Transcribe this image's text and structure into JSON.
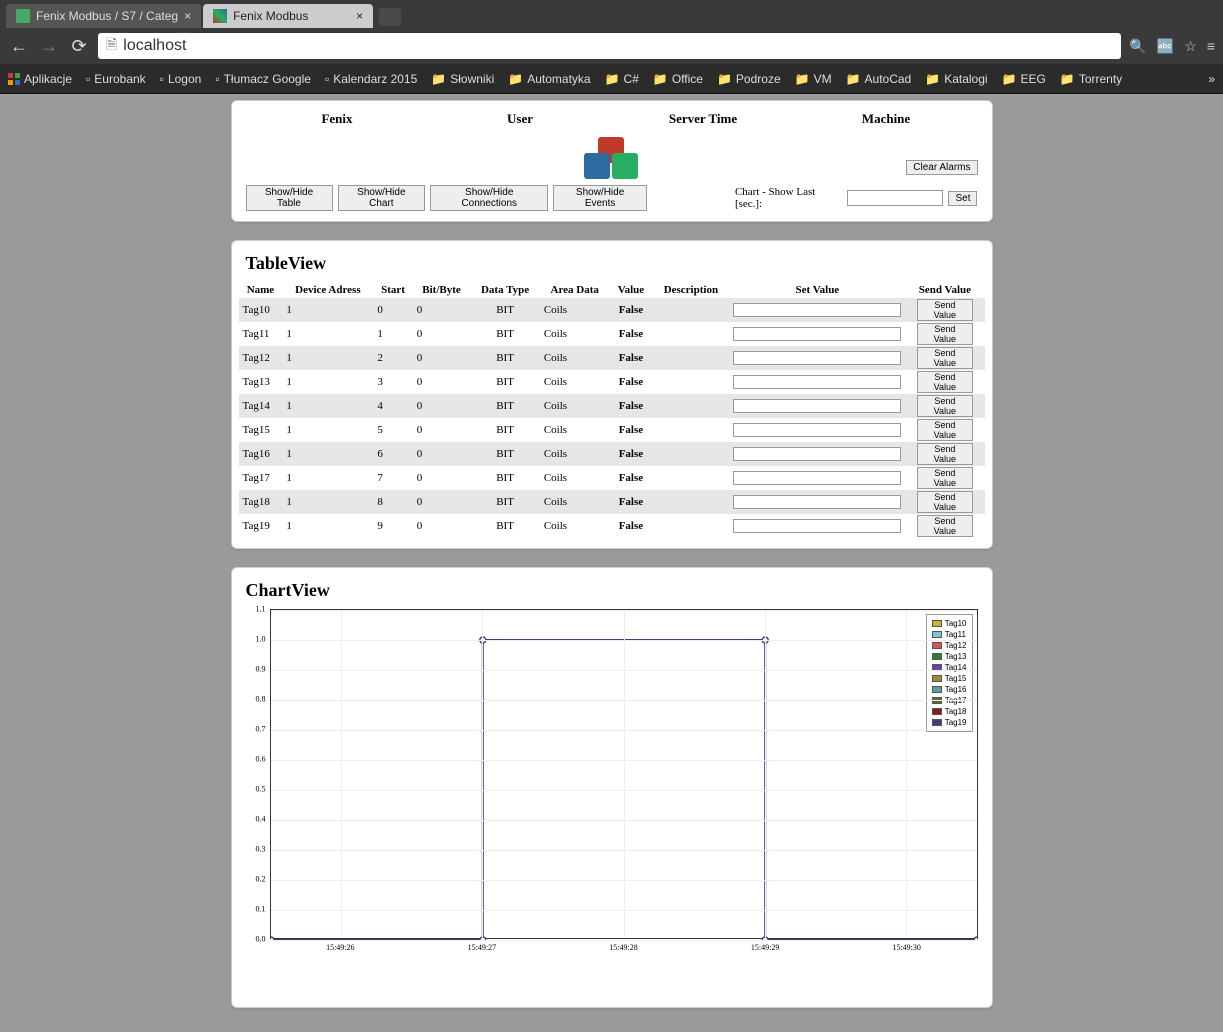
{
  "browser": {
    "tabs": [
      {
        "title": "Fenix Modbus / S7 / Categ",
        "active": false
      },
      {
        "title": "Fenix Modbus",
        "active": true
      }
    ],
    "url": "localhost",
    "bookmarks_label": "Aplikacje",
    "bookmarks": [
      {
        "label": "Eurobank",
        "type": "site"
      },
      {
        "label": "Logon",
        "type": "page"
      },
      {
        "label": "Tłumacz Google",
        "type": "site"
      },
      {
        "label": "Kalendarz 2015",
        "type": "site"
      },
      {
        "label": "Słowniki",
        "type": "folder"
      },
      {
        "label": "Automatyka",
        "type": "folder"
      },
      {
        "label": "C#",
        "type": "folder"
      },
      {
        "label": "Office",
        "type": "folder"
      },
      {
        "label": "Podroze",
        "type": "folder"
      },
      {
        "label": "VM",
        "type": "folder"
      },
      {
        "label": "AutoCad",
        "type": "folder"
      },
      {
        "label": "Katalogi",
        "type": "folder"
      },
      {
        "label": "EEG",
        "type": "folder"
      },
      {
        "label": "Torrenty",
        "type": "folder"
      }
    ]
  },
  "header": {
    "cols": [
      "Fenix",
      "User",
      "Server Time",
      "Machine"
    ],
    "clear_alarms": "Clear Alarms"
  },
  "controls": {
    "show_table": "Show/Hide Table",
    "show_chart": "Show/Hide Chart",
    "show_conn": "Show/Hide Connections",
    "show_events": "Show/Hide Events",
    "chart_last_label": "Chart - Show Last [sec.]:",
    "set": "Set"
  },
  "table": {
    "title": "TableView",
    "headers": [
      "Name",
      "Device Adress",
      "Start",
      "Bit/Byte",
      "Data Type",
      "Area Data",
      "Value",
      "Description",
      "Set Value",
      "Send Value"
    ],
    "rows": [
      {
        "name": "Tag10",
        "dev": "1",
        "start": "0",
        "bit": "0",
        "type": "BIT",
        "area": "Coils",
        "val": "False"
      },
      {
        "name": "Tag11",
        "dev": "1",
        "start": "1",
        "bit": "0",
        "type": "BIT",
        "area": "Coils",
        "val": "False"
      },
      {
        "name": "Tag12",
        "dev": "1",
        "start": "2",
        "bit": "0",
        "type": "BIT",
        "area": "Coils",
        "val": "False"
      },
      {
        "name": "Tag13",
        "dev": "1",
        "start": "3",
        "bit": "0",
        "type": "BIT",
        "area": "Coils",
        "val": "False"
      },
      {
        "name": "Tag14",
        "dev": "1",
        "start": "4",
        "bit": "0",
        "type": "BIT",
        "area": "Coils",
        "val": "False"
      },
      {
        "name": "Tag15",
        "dev": "1",
        "start": "5",
        "bit": "0",
        "type": "BIT",
        "area": "Coils",
        "val": "False"
      },
      {
        "name": "Tag16",
        "dev": "1",
        "start": "6",
        "bit": "0",
        "type": "BIT",
        "area": "Coils",
        "val": "False"
      },
      {
        "name": "Tag17",
        "dev": "1",
        "start": "7",
        "bit": "0",
        "type": "BIT",
        "area": "Coils",
        "val": "False"
      },
      {
        "name": "Tag18",
        "dev": "1",
        "start": "8",
        "bit": "0",
        "type": "BIT",
        "area": "Coils",
        "val": "False"
      },
      {
        "name": "Tag19",
        "dev": "1",
        "start": "9",
        "bit": "0",
        "type": "BIT",
        "area": "Coils",
        "val": "False"
      }
    ],
    "send_btn": "Send Value"
  },
  "chart": {
    "title": "ChartView"
  },
  "chart_data": {
    "type": "line",
    "xlabel": "",
    "ylabel": "",
    "ylim": [
      0.0,
      1.1
    ],
    "y_ticks": [
      0.0,
      0.1,
      0.2,
      0.3,
      0.4,
      0.5,
      0.6,
      0.7,
      0.8,
      0.9,
      1.0,
      1.1
    ],
    "x_ticks": [
      "15:49:26",
      "15:49:27",
      "15:49:28",
      "15:49:29",
      "15:49:30"
    ],
    "series": [
      {
        "name": "Tag10",
        "color": "#c9b037",
        "x": [
          "15:49:25.5",
          "15:49:27",
          "15:49:27",
          "15:49:29",
          "15:49:29",
          "15:49:30.5"
        ],
        "y": [
          0,
          0,
          1,
          1,
          0,
          0
        ]
      },
      {
        "name": "Tag11",
        "color": "#7ec8c8",
        "x": [],
        "y": []
      },
      {
        "name": "Tag12",
        "color": "#d9534f",
        "x": [],
        "y": []
      },
      {
        "name": "Tag13",
        "color": "#2e7d32",
        "x": [],
        "y": []
      },
      {
        "name": "Tag14",
        "color": "#6a3fb5",
        "x": [],
        "y": []
      },
      {
        "name": "Tag15",
        "color": "#a08a3a",
        "x": [],
        "y": []
      },
      {
        "name": "Tag16",
        "color": "#5f9ea0",
        "x": [],
        "y": []
      },
      {
        "name": "Tag17",
        "color": "#556b2f",
        "x": [],
        "y": []
      },
      {
        "name": "Tag18",
        "color": "#8b1a1a",
        "x": [],
        "y": []
      },
      {
        "name": "Tag19",
        "color": "#4b3a78",
        "x": [],
        "y": []
      }
    ]
  }
}
